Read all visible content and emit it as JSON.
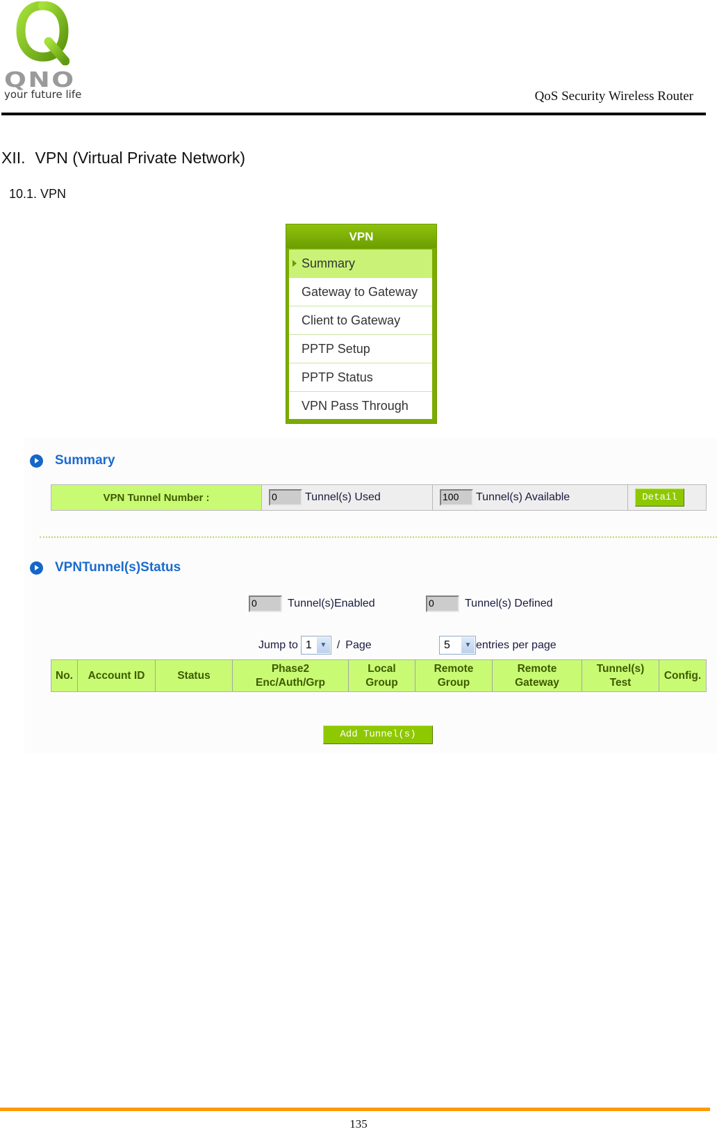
{
  "header": {
    "logo_word": "QNO",
    "logo_tagline": "your future life",
    "doc_title": "QoS Security Wireless Router"
  },
  "chapter": {
    "number": "XII.",
    "title": "VPN (Virtual Private Network)"
  },
  "section": {
    "title": "10.1. VPN"
  },
  "colors": {
    "menu_green": "#7cab00",
    "header_cell_green": "#c9fa74",
    "title_blue": "#1a6bd0",
    "footer_orange": "#ff9900"
  },
  "vpn_menu": {
    "title": "VPN",
    "items": [
      {
        "label": "Summary",
        "active": true
      },
      {
        "label": "Gateway to Gateway",
        "active": false
      },
      {
        "label": "Client to Gateway",
        "active": false
      },
      {
        "label": "PPTP Setup",
        "active": false
      },
      {
        "label": "PPTP Status",
        "active": false
      },
      {
        "label": "VPN Pass Through",
        "active": false
      }
    ]
  },
  "summary": {
    "title": "Summary",
    "tunnel_number_label": "VPN Tunnel Number :",
    "used_value": "0",
    "used_label": "Tunnel(s) Used",
    "available_value": "100",
    "available_label": "Tunnel(s) Available",
    "detail_button": "Detail"
  },
  "tunnel_status": {
    "title": "VPNTunnel(s)Status",
    "enabled_value": "0",
    "enabled_label": "Tunnel(s)Enabled",
    "defined_value": "0",
    "defined_label": "Tunnel(s) Defined",
    "jump_to_label": "Jump to",
    "jump_to_value": "1",
    "page_separator": "/",
    "page_label": "Page",
    "entries_value": "5",
    "entries_label": "entries per page",
    "columns": [
      "No.",
      "Account ID",
      "Status",
      "Phase2\nEnc/Auth/Grp",
      "Local\nGroup",
      "Remote\nGroup",
      "Remote\nGateway",
      "Tunnel(s)\nTest",
      "Config."
    ],
    "add_button": "Add Tunnel(s)"
  },
  "footer": {
    "page_number": "135"
  }
}
